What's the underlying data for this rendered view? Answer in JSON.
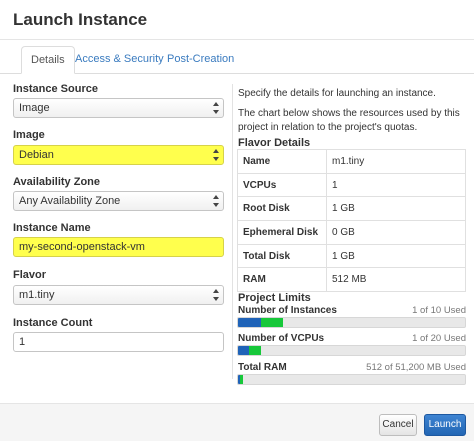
{
  "modal": {
    "title": "Launch Instance"
  },
  "tabs": [
    {
      "label": "Details",
      "active": true
    },
    {
      "label": "Access & Security",
      "active": false
    },
    {
      "label": "Post-Creation",
      "active": false
    }
  ],
  "form": {
    "instance_source": {
      "label": "Instance Source",
      "value": "Image"
    },
    "image": {
      "label": "Image",
      "value": "Debian"
    },
    "availability_zone": {
      "label": "Availability Zone",
      "value": "Any Availability Zone"
    },
    "instance_name": {
      "label": "Instance Name",
      "value": "my-second-openstack-vm"
    },
    "flavor": {
      "label": "Flavor",
      "value": "m1.tiny"
    },
    "instance_count": {
      "label": "Instance Count",
      "value": "1"
    }
  },
  "help": {
    "line1": "Specify the details for launching an instance.",
    "line2": "The chart below shows the resources used by this project in relation to the project's quotas."
  },
  "flavor_details": {
    "title": "Flavor Details",
    "rows": [
      {
        "key": "Name",
        "value": "m1.tiny"
      },
      {
        "key": "VCPUs",
        "value": "1"
      },
      {
        "key": "Root Disk",
        "value": "1 GB"
      },
      {
        "key": "Ephemeral Disk",
        "value": "0 GB"
      },
      {
        "key": "Total Disk",
        "value": "1 GB"
      },
      {
        "key": "RAM",
        "value": "512 MB"
      }
    ]
  },
  "limits": {
    "title": "Project Limits",
    "items": [
      {
        "name": "Number of Instances",
        "used_text": "1 of 10 Used",
        "used_fraction": 0.1,
        "added_fraction": 0.1
      },
      {
        "name": "Number of VCPUs",
        "used_text": "1 of 20 Used",
        "used_fraction": 0.05,
        "added_fraction": 0.05
      },
      {
        "name": "Total RAM",
        "used_text": "512 of 51,200 MB Used",
        "used_fraction": 0.01,
        "added_fraction": 0.01
      }
    ]
  },
  "colors": {
    "used": "#1f63b8",
    "added": "#17c83a",
    "highlight": "#ffff4d",
    "primary": "#2d72c2"
  },
  "footer": {
    "cancel_label": "Cancel",
    "launch_label": "Launch"
  }
}
